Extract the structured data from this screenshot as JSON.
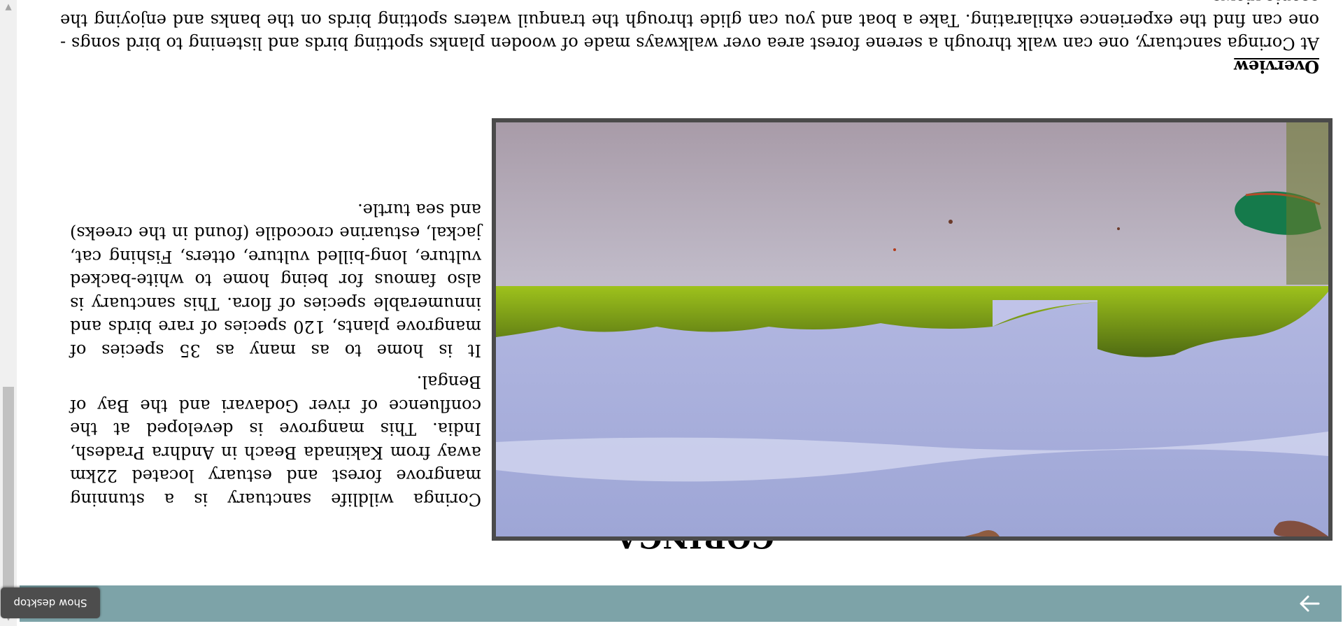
{
  "page": {
    "title": "CORINGA",
    "description_paragraphs": [
      "Coringa wildlife sanctuary is a stunning mangrove forest and estuary located 22km away from Kakinada Beach in Andhra Pradesh, India. This mangrove is developed at the confluence of river Godavari and the Bay of Bengal.",
      "It is home to as many as 35 species of mangrove plants, 120 species of rare birds and innumerable species of flora. This sanctuary is also famous for being home to white-backed vulture, long-billed vulture, otters, Fishing cat, jackal, estuarine crocodile (found in the creeks) and sea turtle."
    ],
    "overview_heading": "Overview",
    "overview_text": "At Coringa sanctuary, one can walk through a serene forest area over walkways made of wooden planks spotting birds and listening to bird songs - one can find the experience exhilarating. Take a boat and you can glide through the tranquil waters spotting birds on the banks and enjoying the scenic views."
  },
  "topbar": {
    "next_icon": "arrow-right-icon",
    "download_icon": "download-arrow-icon",
    "color": "#7da3a8"
  },
  "taskbar": {
    "show_desktop_label": "Show desktop"
  },
  "photo": {
    "description_icon": "mangrove-backwater-photo"
  }
}
